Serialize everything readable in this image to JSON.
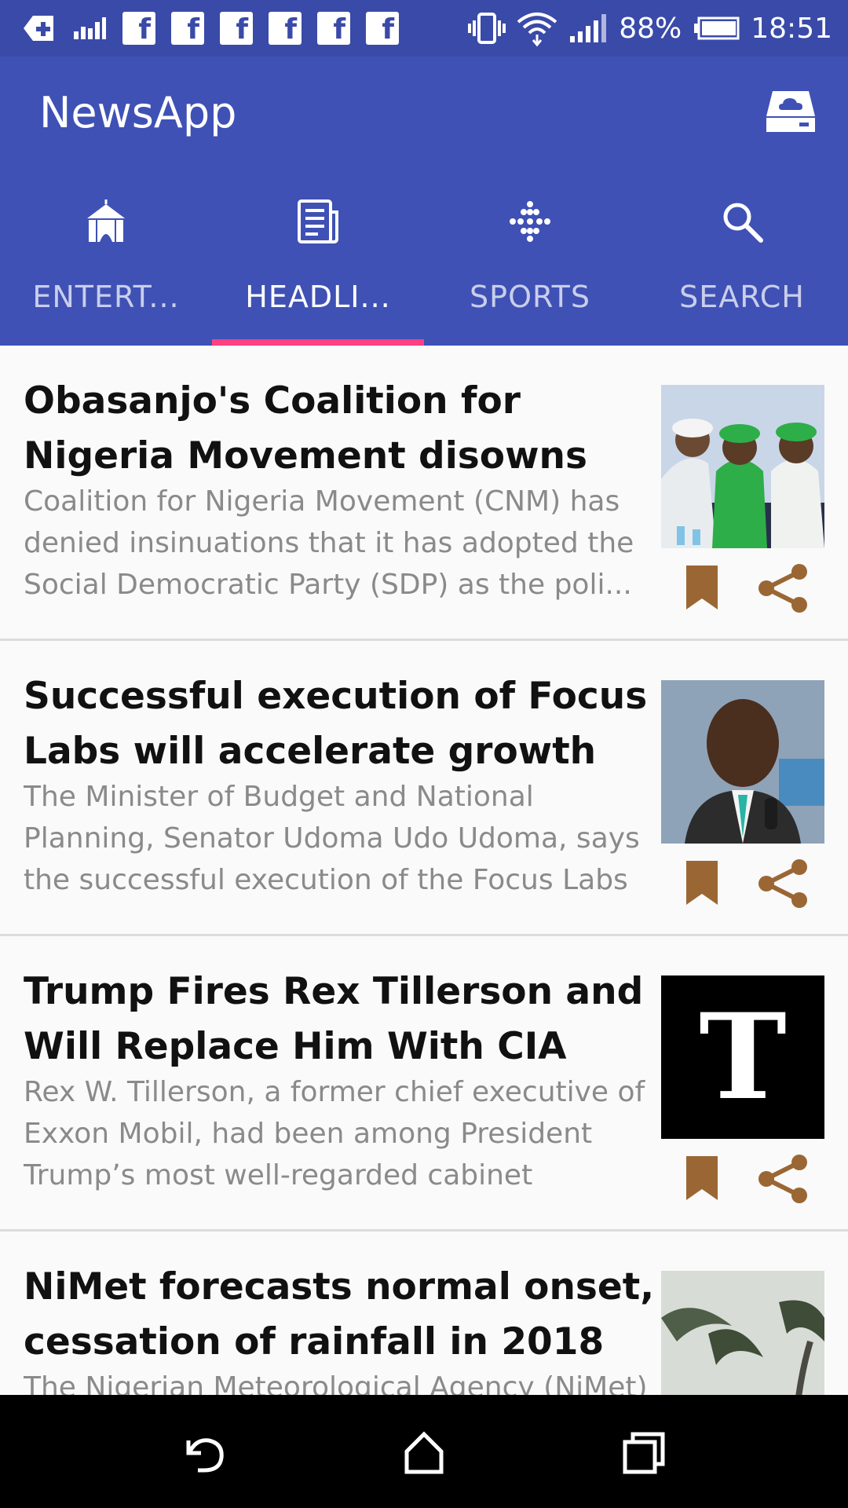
{
  "status_bar": {
    "battery": "88%",
    "time": "18:51",
    "icons": [
      "health-plus-icon",
      "signal-bars-icon",
      "facebook-icon",
      "facebook-icon",
      "facebook-icon",
      "facebook-icon",
      "facebook-icon",
      "facebook-icon",
      "vibrate-icon",
      "wifi-icon",
      "cell-signal-icon",
      "battery-icon"
    ]
  },
  "app_bar": {
    "title": "NewsApp",
    "action_icon": "cloud-storage-icon"
  },
  "tabs": [
    {
      "label": "ENTERT...",
      "icon": "circus-tent-icon",
      "active": false
    },
    {
      "label": "HEADLI...",
      "icon": "newspaper-icon",
      "active": true
    },
    {
      "label": "SPORTS",
      "icon": "dots-icon",
      "active": false
    },
    {
      "label": "SEARCH",
      "icon": "search-icon",
      "active": false
    }
  ],
  "articles": [
    {
      "headline": "Obasanjo's Coalition for Nigeria Movement disowns SDP",
      "summary": "Coalition for Nigeria Movement (CNM) has denied insinuations that it has adopted the Social Democratic Party (SDP) as the poli...",
      "thumbnail": "men-green-caps-photo"
    },
    {
      "headline": "Successful execution of Focus Labs will accelerate growth m...",
      "summary": "The Minister of Budget and National Planning, Senator Udoma Udo Udoma, says the successful execution of the Focus Labs by Pr...",
      "thumbnail": "minister-portrait-photo"
    },
    {
      "headline": "Trump Fires Rex Tillerson and Will Replace Him With CIA Chi...",
      "summary": "Rex W. Tillerson, a former chief executive of Exxon Mobil, had been among President Trump’s most well-regarded cabinet choices....",
      "thumbnail": "nyt-logo",
      "thumbnail_letter": "T"
    },
    {
      "headline": "NiMet forecasts normal onset, cessation of rainfall in 2018",
      "summary": "The Nigerian Meteorological Agency (NiMet)",
      "thumbnail": "palm-trees-storm-photo"
    }
  ],
  "colors": {
    "status_bar": "#3a4aa8",
    "app_bar": "#3f51b5",
    "tab_indicator": "#ff4081",
    "action_icon": "#9a6734"
  },
  "nav_bar": {
    "back_icon": "back-icon",
    "home_icon": "home-icon",
    "recents_icon": "recents-icon"
  }
}
